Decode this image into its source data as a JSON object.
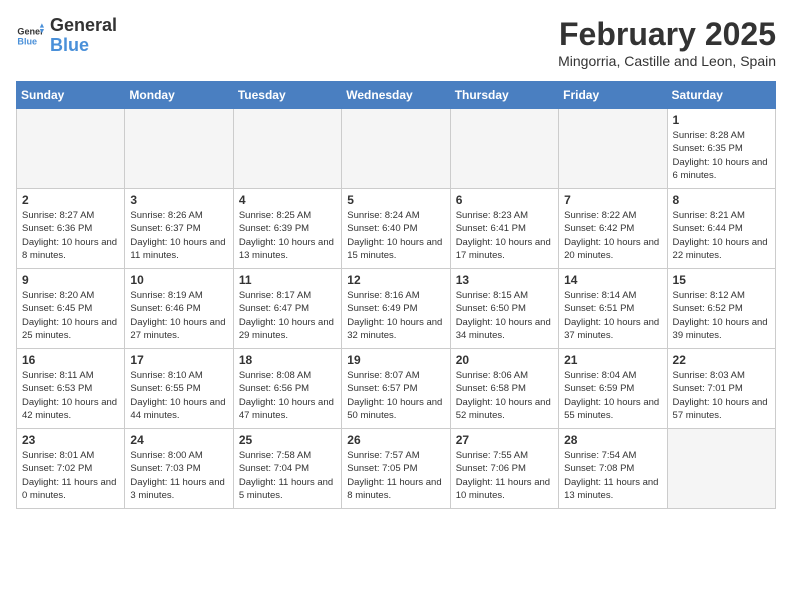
{
  "header": {
    "logo_general": "General",
    "logo_blue": "Blue",
    "month_year": "February 2025",
    "location": "Mingorria, Castille and Leon, Spain"
  },
  "days_of_week": [
    "Sunday",
    "Monday",
    "Tuesday",
    "Wednesday",
    "Thursday",
    "Friday",
    "Saturday"
  ],
  "weeks": [
    [
      {
        "day": "",
        "info": ""
      },
      {
        "day": "",
        "info": ""
      },
      {
        "day": "",
        "info": ""
      },
      {
        "day": "",
        "info": ""
      },
      {
        "day": "",
        "info": ""
      },
      {
        "day": "",
        "info": ""
      },
      {
        "day": "1",
        "info": "Sunrise: 8:28 AM\nSunset: 6:35 PM\nDaylight: 10 hours and 6 minutes."
      }
    ],
    [
      {
        "day": "2",
        "info": "Sunrise: 8:27 AM\nSunset: 6:36 PM\nDaylight: 10 hours and 8 minutes."
      },
      {
        "day": "3",
        "info": "Sunrise: 8:26 AM\nSunset: 6:37 PM\nDaylight: 10 hours and 11 minutes."
      },
      {
        "day": "4",
        "info": "Sunrise: 8:25 AM\nSunset: 6:39 PM\nDaylight: 10 hours and 13 minutes."
      },
      {
        "day": "5",
        "info": "Sunrise: 8:24 AM\nSunset: 6:40 PM\nDaylight: 10 hours and 15 minutes."
      },
      {
        "day": "6",
        "info": "Sunrise: 8:23 AM\nSunset: 6:41 PM\nDaylight: 10 hours and 17 minutes."
      },
      {
        "day": "7",
        "info": "Sunrise: 8:22 AM\nSunset: 6:42 PM\nDaylight: 10 hours and 20 minutes."
      },
      {
        "day": "8",
        "info": "Sunrise: 8:21 AM\nSunset: 6:44 PM\nDaylight: 10 hours and 22 minutes."
      }
    ],
    [
      {
        "day": "9",
        "info": "Sunrise: 8:20 AM\nSunset: 6:45 PM\nDaylight: 10 hours and 25 minutes."
      },
      {
        "day": "10",
        "info": "Sunrise: 8:19 AM\nSunset: 6:46 PM\nDaylight: 10 hours and 27 minutes."
      },
      {
        "day": "11",
        "info": "Sunrise: 8:17 AM\nSunset: 6:47 PM\nDaylight: 10 hours and 29 minutes."
      },
      {
        "day": "12",
        "info": "Sunrise: 8:16 AM\nSunset: 6:49 PM\nDaylight: 10 hours and 32 minutes."
      },
      {
        "day": "13",
        "info": "Sunrise: 8:15 AM\nSunset: 6:50 PM\nDaylight: 10 hours and 34 minutes."
      },
      {
        "day": "14",
        "info": "Sunrise: 8:14 AM\nSunset: 6:51 PM\nDaylight: 10 hours and 37 minutes."
      },
      {
        "day": "15",
        "info": "Sunrise: 8:12 AM\nSunset: 6:52 PM\nDaylight: 10 hours and 39 minutes."
      }
    ],
    [
      {
        "day": "16",
        "info": "Sunrise: 8:11 AM\nSunset: 6:53 PM\nDaylight: 10 hours and 42 minutes."
      },
      {
        "day": "17",
        "info": "Sunrise: 8:10 AM\nSunset: 6:55 PM\nDaylight: 10 hours and 44 minutes."
      },
      {
        "day": "18",
        "info": "Sunrise: 8:08 AM\nSunset: 6:56 PM\nDaylight: 10 hours and 47 minutes."
      },
      {
        "day": "19",
        "info": "Sunrise: 8:07 AM\nSunset: 6:57 PM\nDaylight: 10 hours and 50 minutes."
      },
      {
        "day": "20",
        "info": "Sunrise: 8:06 AM\nSunset: 6:58 PM\nDaylight: 10 hours and 52 minutes."
      },
      {
        "day": "21",
        "info": "Sunrise: 8:04 AM\nSunset: 6:59 PM\nDaylight: 10 hours and 55 minutes."
      },
      {
        "day": "22",
        "info": "Sunrise: 8:03 AM\nSunset: 7:01 PM\nDaylight: 10 hours and 57 minutes."
      }
    ],
    [
      {
        "day": "23",
        "info": "Sunrise: 8:01 AM\nSunset: 7:02 PM\nDaylight: 11 hours and 0 minutes."
      },
      {
        "day": "24",
        "info": "Sunrise: 8:00 AM\nSunset: 7:03 PM\nDaylight: 11 hours and 3 minutes."
      },
      {
        "day": "25",
        "info": "Sunrise: 7:58 AM\nSunset: 7:04 PM\nDaylight: 11 hours and 5 minutes."
      },
      {
        "day": "26",
        "info": "Sunrise: 7:57 AM\nSunset: 7:05 PM\nDaylight: 11 hours and 8 minutes."
      },
      {
        "day": "27",
        "info": "Sunrise: 7:55 AM\nSunset: 7:06 PM\nDaylight: 11 hours and 10 minutes."
      },
      {
        "day": "28",
        "info": "Sunrise: 7:54 AM\nSunset: 7:08 PM\nDaylight: 11 hours and 13 minutes."
      },
      {
        "day": "",
        "info": ""
      }
    ]
  ]
}
